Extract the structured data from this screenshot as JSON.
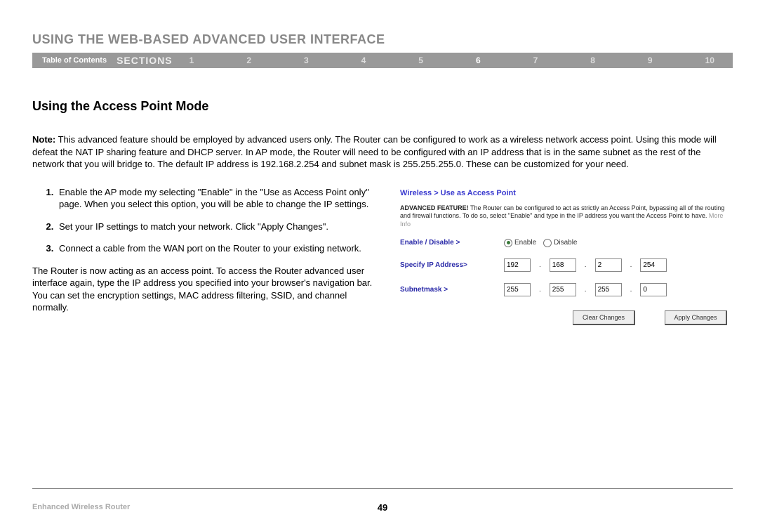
{
  "header": {
    "chapter_title": "USING THE WEB-BASED ADVANCED USER INTERFACE",
    "toc_label": "Table of Contents",
    "sections_label": "SECTIONS",
    "numbers": [
      "1",
      "2",
      "3",
      "4",
      "5",
      "6",
      "7",
      "8",
      "9",
      "10"
    ],
    "active": "6"
  },
  "body": {
    "section_title": "Using the Access Point Mode",
    "note_label": "Note:",
    "note_text": " This advanced feature should be employed by advanced users only. The Router can be configured to work as a wireless network access point. Using this mode will defeat the NAT IP sharing feature and DHCP server. In AP mode, the Router will need to be configured with an IP address that is in the same subnet as the rest of the network that you will bridge to. The default IP address is 192.168.2.254 and subnet mask is 255.255.255.0. These can be customized for your need.",
    "steps": [
      "Enable the AP mode my selecting \"Enable\" in the \"Use as Access Point only\" page. When you select this option, you will be able to change the IP settings.",
      "Set your IP settings to match your network. Click \"Apply Changes\".",
      "Connect a cable from the WAN port on the Router to your existing network."
    ],
    "closing": "The Router is now acting as an access point. To access the Router advanced user interface again, type the IP address you specified into your browser's navigation bar. You can set the encryption settings, MAC address filtering, SSID, and channel normally."
  },
  "panel": {
    "breadcrumb": "Wireless > Use as Access Point",
    "adv_label": "ADVANCED FEATURE!",
    "adv_text": " The Router can be configured to act as strictly an Access Point, bypassing all of the routing and firewall functions. To do so, select \"Enable\" and type in the IP address you want the Access Point to have. ",
    "more_info": "More Info",
    "rows": {
      "enable_label": "Enable / Disable >",
      "enable_opt": "Enable",
      "disable_opt": "Disable",
      "ip_label": "Specify IP Address>",
      "ip": [
        "192",
        "168",
        "2",
        "254"
      ],
      "mask_label": "Subnetmask >",
      "mask": [
        "255",
        "255",
        "255",
        "0"
      ]
    },
    "buttons": {
      "clear": "Clear Changes",
      "apply": "Apply Changes"
    }
  },
  "footer": {
    "product": "Enhanced Wireless Router",
    "page_number": "49"
  }
}
